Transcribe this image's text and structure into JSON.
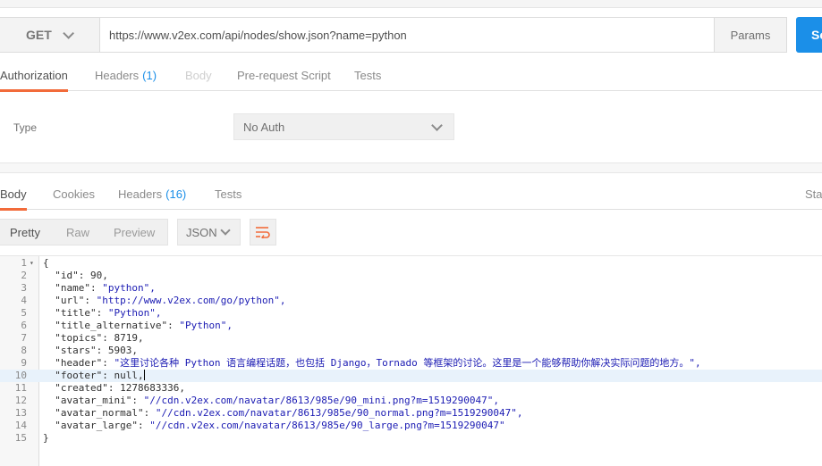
{
  "request": {
    "method": "GET",
    "url": "https://www.v2ex.com/api/nodes/show.json?name=python",
    "params_label": "Params",
    "send_label": "Send"
  },
  "request_tabs": [
    {
      "label": "Authorization",
      "active": true
    },
    {
      "label": "Headers",
      "count": "(1)"
    },
    {
      "label": "Body",
      "disabled": true
    },
    {
      "label": "Pre-request Script"
    },
    {
      "label": "Tests"
    }
  ],
  "auth": {
    "type_label": "Type",
    "type_value": "No Auth"
  },
  "response_tabs": [
    {
      "label": "Body",
      "active": true
    },
    {
      "label": "Cookies"
    },
    {
      "label": "Headers",
      "count": "(16)"
    },
    {
      "label": "Tests"
    },
    {
      "label": "Status"
    }
  ],
  "view_modes": [
    "Pretty",
    "Raw",
    "Preview"
  ],
  "active_view": "Pretty",
  "format": "JSON",
  "icons": {
    "method_chevron": "chevron-down-icon",
    "wrap": "wrap-lines-icon",
    "accent_color": "#f26b3a",
    "send_color": "#1b8fe8"
  },
  "response_lines": [
    {
      "n": "1",
      "text": "{"
    },
    {
      "n": "2",
      "key": "\"id\"",
      "val": "90,",
      "type": "num"
    },
    {
      "n": "3",
      "key": "\"name\"",
      "val": "\"python\",",
      "type": "str"
    },
    {
      "n": "4",
      "key": "\"url\"",
      "val": "\"http://www.v2ex.com/go/python\",",
      "type": "str"
    },
    {
      "n": "5",
      "key": "\"title\"",
      "val": "\"Python\",",
      "type": "str"
    },
    {
      "n": "6",
      "key": "\"title_alternative\"",
      "val": "\"Python\",",
      "type": "str"
    },
    {
      "n": "7",
      "key": "\"topics\"",
      "val": "8719,",
      "type": "num"
    },
    {
      "n": "8",
      "key": "\"stars\"",
      "val": "5903,",
      "type": "num"
    },
    {
      "n": "9",
      "key": "\"header\"",
      "val": "\"这里讨论各种 Python 语言编程话题，也包括 Django，Tornado 等框架的讨论。这里是一个能够帮助你解决实际问题的地方。\",",
      "type": "str"
    },
    {
      "n": "10",
      "key": "\"footer\"",
      "val": "null,",
      "type": "num",
      "current": true
    },
    {
      "n": "11",
      "key": "\"created\"",
      "val": "1278683336,",
      "type": "num"
    },
    {
      "n": "12",
      "key": "\"avatar_mini\"",
      "val": "\"//cdn.v2ex.com/navatar/8613/985e/90_mini.png?m=1519290047\",",
      "type": "str"
    },
    {
      "n": "13",
      "key": "\"avatar_normal\"",
      "val": "\"//cdn.v2ex.com/navatar/8613/985e/90_normal.png?m=1519290047\",",
      "type": "str"
    },
    {
      "n": "14",
      "key": "\"avatar_large\"",
      "val": "\"//cdn.v2ex.com/navatar/8613/985e/90_large.png?m=1519290047\"",
      "type": "str"
    },
    {
      "n": "15",
      "text": "}"
    }
  ]
}
